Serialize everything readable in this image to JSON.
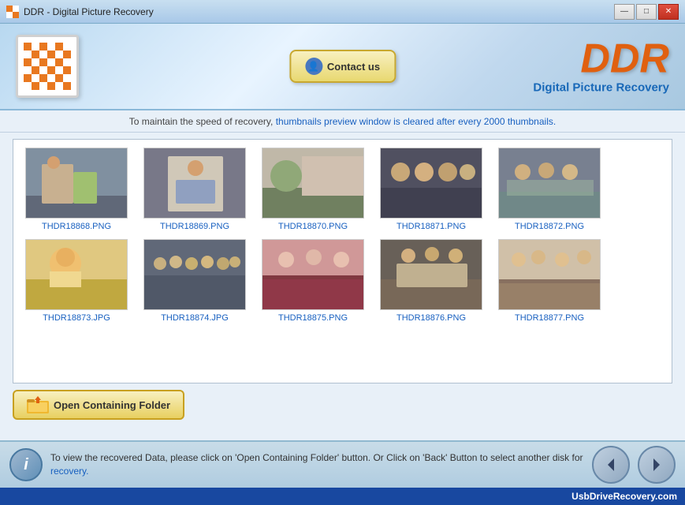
{
  "window": {
    "title": "DDR - Digital Picture Recovery",
    "controls": {
      "minimize": "—",
      "maximize": "□",
      "close": "✕"
    }
  },
  "header": {
    "contact_button": "Contact us",
    "ddr_title": "DDR",
    "subtitle": "Digital Picture Recovery"
  },
  "info_bar": {
    "text_before": "To maintain the speed of recovery, ",
    "highlighted": "thumbnails preview window is cleared after every 2000 thumbnails.",
    "text_after": ""
  },
  "thumbnails": [
    {
      "label": "THDR18868.PNG",
      "color1": "#8090a0",
      "color2": "#c8b090"
    },
    {
      "label": "THDR18869.PNG",
      "color1": "#606878",
      "color2": "#d0c8b8"
    },
    {
      "label": "THDR18870.PNG",
      "color1": "#706870",
      "color2": "#c0b0a0"
    },
    {
      "label": "THDR18871.PNG",
      "color1": "#505060",
      "color2": "#b8a890"
    },
    {
      "label": "THDR18872.PNG",
      "color1": "#788088",
      "color2": "#c8c0b0"
    },
    {
      "label": "THDR18873.JPG",
      "color1": "#c08840",
      "color2": "#e8d0a0"
    },
    {
      "label": "THDR18874.JPG",
      "color1": "#606878",
      "color2": "#b0b8c8"
    },
    {
      "label": "THDR18875.PNG",
      "color1": "#803838",
      "color2": "#d09898"
    },
    {
      "label": "THDR18876.PNG",
      "color1": "#686058",
      "color2": "#b8b0a0"
    },
    {
      "label": "THDR18877.PNG",
      "color1": "#887060",
      "color2": "#d0c0a8"
    }
  ],
  "open_folder_btn": "Open Containing Folder",
  "bottom": {
    "info_text_before": "To view the recovered Data, please click on 'Open Containing Folder' button. Or Click on 'Back' Button to select another disk for",
    "info_text_highlighted": "recovery.",
    "back_icon": "◀",
    "forward_icon": "▶"
  },
  "status_bar": {
    "text": "UsbDriveRecovery.com"
  }
}
